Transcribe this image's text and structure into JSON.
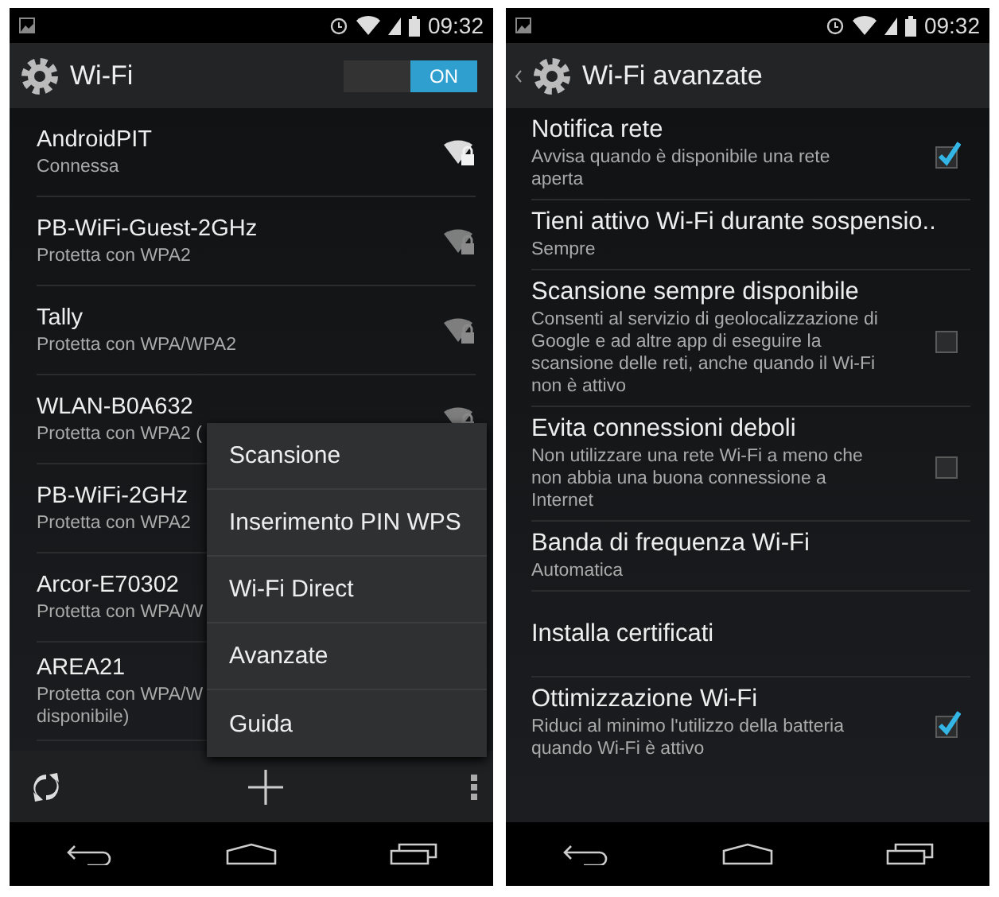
{
  "screens": [
    {
      "status_bar": {
        "time": "09:32"
      },
      "action_bar": {
        "title": "Wi-Fi",
        "back": false,
        "switch": {
          "label": "ON",
          "on": true
        }
      },
      "networks": [
        {
          "name": "AndroidPIT",
          "status": "Connessa",
          "icon": {
            "connected": true
          }
        },
        {
          "name": "PB-WiFi-Guest-2GHz",
          "status": "Protetta con WPA2",
          "icon": {
            "connected": false
          }
        },
        {
          "name": "Tally",
          "status": "Protetta con WPA/WPA2",
          "icon": {
            "connected": false
          }
        },
        {
          "name": "WLAN-B0A632",
          "status": "Protetta con WPA2 (",
          "icon": {
            "connected": false
          }
        },
        {
          "name": "PB-WiFi-2GHz",
          "status": "Protetta con WPA2"
        },
        {
          "name": "Arcor-E70302",
          "status": "Protetta con WPA/W"
        },
        {
          "name": "AREA21",
          "status": "Protetta con WPA/W\ndisponibile)"
        }
      ],
      "menu": [
        "Scansione",
        "Inserimento PIN WPS",
        "Wi-Fi Direct",
        "Avanzate",
        "Guida"
      ]
    },
    {
      "status_bar": {
        "time": "09:32"
      },
      "action_bar": {
        "title": "Wi-Fi avanzate",
        "back": true
      },
      "settings": [
        {
          "kind": "check",
          "title": "Notifica rete",
          "summary": "Avvisa quando è disponibile una rete aperta",
          "checked": true
        },
        {
          "kind": "plain",
          "title": "Tieni attivo Wi-Fi durante sospensio..",
          "summary": "Sempre"
        },
        {
          "kind": "check",
          "title": "Scansione sempre disponibile",
          "summary": "Consenti al servizio di geolocalizzazione di Google e ad altre app di eseguire la scansione delle reti, anche quando il Wi-Fi non è attivo",
          "checked": false
        },
        {
          "kind": "check",
          "title": "Evita connessioni deboli",
          "summary": "Non utilizzare una rete Wi-Fi a meno che non abbia una buona connessione a Internet",
          "checked": false
        },
        {
          "kind": "plain",
          "title": "Banda di frequenza Wi-Fi",
          "summary": "Automatica"
        },
        {
          "kind": "plain",
          "title": "Installa certificati"
        },
        {
          "kind": "check",
          "title": "Ottimizzazione Wi-Fi",
          "summary": "Riduci al minimo l'utilizzo della batteria quando Wi-Fi è attivo",
          "checked": true
        }
      ]
    }
  ]
}
